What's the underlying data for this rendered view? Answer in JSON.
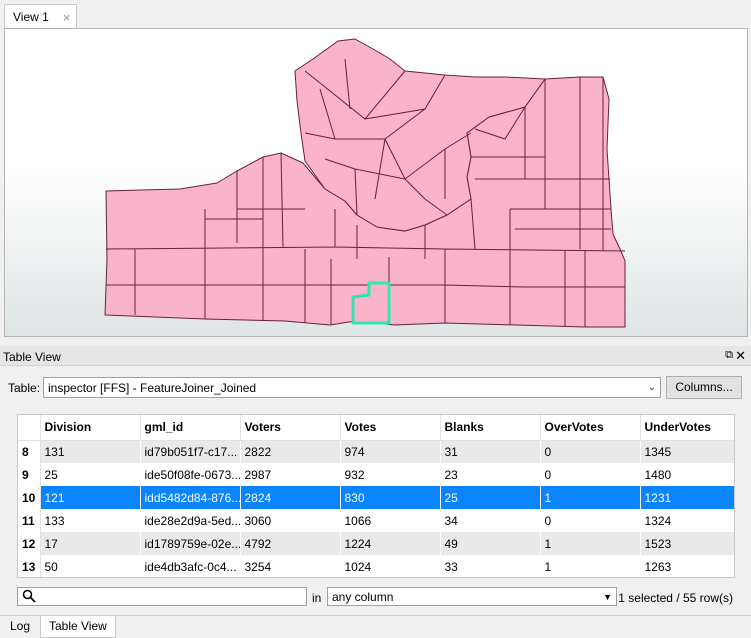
{
  "view_tab": {
    "label": "View 1",
    "close_glyph": "×"
  },
  "panel": {
    "title": "Table View",
    "float_glyph": "⧉",
    "close_glyph": "✕"
  },
  "table_selector": {
    "label": "Table:",
    "value": "inspector [FFS] - FeatureJoiner_Joined",
    "columns_button": "Columns..."
  },
  "grid": {
    "columns": [
      "Division",
      "gml_id",
      "Voters",
      "Votes",
      "Blanks",
      "OverVotes",
      "UnderVotes"
    ],
    "rows": [
      {
        "num": "8",
        "cells": [
          "131",
          "id79b051f7-c17...",
          "2822",
          "974",
          "31",
          "0",
          "1345"
        ]
      },
      {
        "num": "9",
        "cells": [
          "25",
          "ide50f08fe-0673...",
          "2987",
          "932",
          "23",
          "0",
          "1480"
        ]
      },
      {
        "num": "10",
        "cells": [
          "121",
          "idd5482d84-876...",
          "2824",
          "830",
          "25",
          "1",
          "1231"
        ]
      },
      {
        "num": "11",
        "cells": [
          "133",
          "ide28e2d9a-5ed...",
          "3060",
          "1066",
          "34",
          "0",
          "1324"
        ]
      },
      {
        "num": "12",
        "cells": [
          "17",
          "id1789759e-02e...",
          "4792",
          "1224",
          "49",
          "1",
          "1523"
        ]
      },
      {
        "num": "13",
        "cells": [
          "50",
          "ide4db3afc-0c4...",
          "3254",
          "1024",
          "33",
          "1",
          "1263"
        ]
      }
    ],
    "selected_row": "10"
  },
  "search": {
    "value": "",
    "in_label": "in",
    "column_option": "any column",
    "status": "1 selected / 55 row(s)"
  },
  "bottom_tabs": {
    "log": "Log",
    "table_view": "Table View"
  },
  "colors": {
    "polygon_fill": "#f9b3cb",
    "polygon_stroke": "#6b1f3a",
    "highlight_stroke": "#2ee6b0",
    "selected_row": "#0a84ff"
  }
}
